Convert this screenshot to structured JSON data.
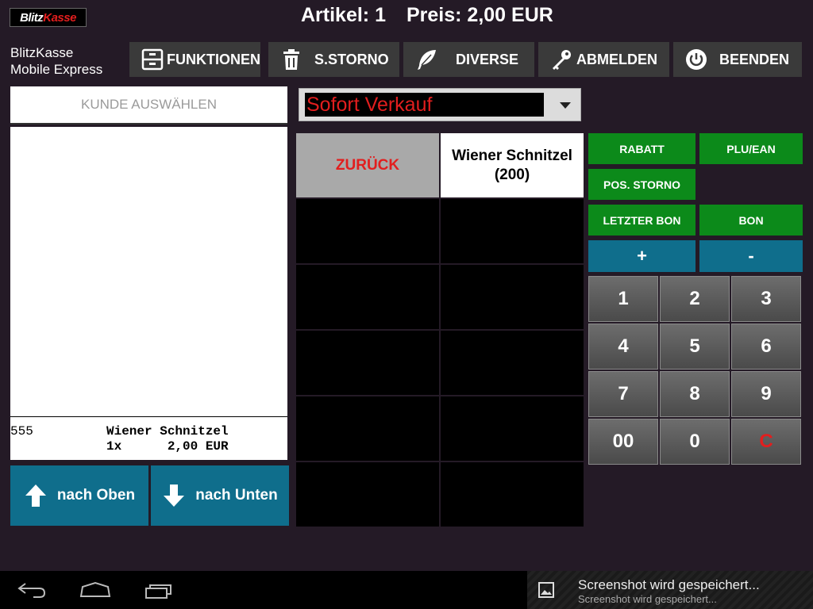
{
  "header": {
    "logo_text_a": "Blitz",
    "logo_text_b": "Kasse",
    "artikel": "Artikel: 1",
    "preis": "Preis: 2,00 EUR"
  },
  "app": {
    "name_line1": "BlitzKasse",
    "name_line2": "Mobile Express"
  },
  "toolbar": {
    "funktionen": "FUNKTIONEN",
    "sstorno": "S.STORNO",
    "diverse": "DIVERSE",
    "abmelden": "ABMELDEN",
    "beenden": "BEENDEN"
  },
  "left": {
    "kunde": "KUNDE AUSWÄHLEN",
    "bon_nr": "555",
    "bon_name": "Wiener Schnitzel",
    "bon_qty": "1x      2,00 EUR",
    "up": "nach Oben",
    "down": "nach Unten"
  },
  "dropdown": {
    "value": "Sofort Verkauf"
  },
  "grid": {
    "back": "ZURÜCK",
    "item": "Wiener Schnitzel (200)"
  },
  "actions": {
    "rabatt": "RABATT",
    "plu": "PLU/EAN",
    "posstorno": "POS. STORNO",
    "letzterbon": "LETZTER BON",
    "bon": "BON",
    "plus": "+",
    "minus": "-"
  },
  "keypad": [
    "1",
    "2",
    "3",
    "4",
    "5",
    "6",
    "7",
    "8",
    "9",
    "00",
    "0",
    "C"
  ],
  "notification": {
    "title": "Screenshot wird gespeichert...",
    "text": "Screenshot wird gespeichert..."
  },
  "colors": {
    "background": "#241a26",
    "green": "#0c8a1a",
    "blue": "#0f6e8c",
    "red": "#e21e1e"
  }
}
